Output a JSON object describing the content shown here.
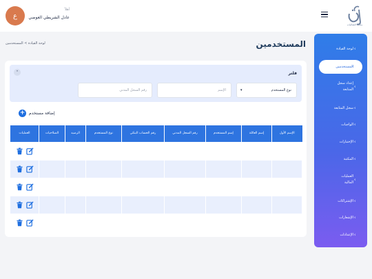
{
  "header": {
    "avatar_initial": "ع",
    "greeting": "أهلاً",
    "user_name": "عادل الشريطي العوضي",
    "logo_text": "مكتب الفعاليات"
  },
  "breadcrumb": "لوحة القيادة > المستخدمين",
  "page_title": "المستخدمين",
  "sidebar": {
    "items": [
      {
        "label": "لوحة القيادة"
      },
      {
        "label": "المستخدمين"
      },
      {
        "label": "إعداد سجل المتابعة"
      },
      {
        "label": "سجل المتابعة"
      },
      {
        "label": "الواجبات"
      },
      {
        "label": "الإختبارات"
      },
      {
        "label": "المكتبة"
      },
      {
        "label": "العمليات المالية"
      },
      {
        "label": "الإشتراكات"
      },
      {
        "label": "الإشعارات"
      },
      {
        "label": "الإعدادات"
      }
    ]
  },
  "filter": {
    "title": "فلتر",
    "user_type_select": "نوع المستخدم",
    "name_placeholder": "الإسم",
    "civil_id_placeholder": "رقم السجل المدني"
  },
  "add_user_label": "إضافة مستخدم",
  "table": {
    "columns": [
      "الإسم الأول",
      "إسم العائلة",
      "إسم المستخدم",
      "رقم السجل المدني",
      "رقم الحساب البنكي",
      "نوع المستخدم",
      "الرصيد",
      "الصلاحيات",
      "العمليات"
    ],
    "rows": [
      [
        "",
        "",
        "",
        "",
        "",
        "",
        "",
        ""
      ],
      [
        "",
        "",
        "",
        "",
        "",
        "",
        "",
        ""
      ],
      [
        "",
        "",
        "",
        "",
        "",
        "",
        "",
        ""
      ],
      [
        "",
        "",
        "",
        "",
        "",
        "",
        "",
        ""
      ],
      [
        "",
        "",
        "",
        "",
        "",
        "",
        "",
        ""
      ]
    ]
  },
  "icons": [
    "menu-icon",
    "chevron-right-icon",
    "chevron-up-icon",
    "chevron-down-icon",
    "plus-icon",
    "edit-icon",
    "trash-icon"
  ],
  "colors": {
    "primary": "#2e74e0",
    "sidebar_top": "#2f7de8",
    "sidebar_bottom": "#7b5cf0",
    "avatar": "#d97a4e",
    "filter_bg": "#e5ecfd",
    "row_alt": "#e9effd"
  }
}
